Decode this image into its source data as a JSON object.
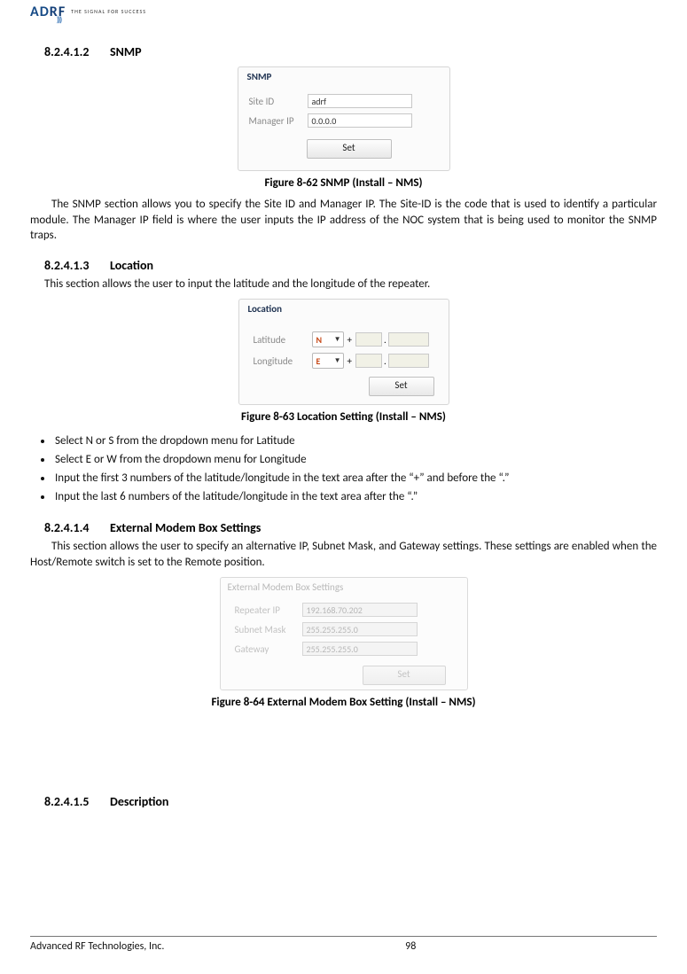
{
  "header": {
    "logo_a": "A",
    "logo_d": "D",
    "logo_r": "R",
    "logo_f": "F",
    "tagline": "THE SIGNAL FOR SUCCESS"
  },
  "sections": {
    "snmp": {
      "num": "8.2.4.1.2",
      "title": "SNMP"
    },
    "location": {
      "num": "8.2.4.1.3",
      "title": "Location"
    },
    "ext": {
      "num": "8.2.4.1.4",
      "title": "External Modem Box Settings"
    },
    "desc": {
      "num": "8.2.4.1.5",
      "title": "Description"
    }
  },
  "snmp_box": {
    "title": "SNMP",
    "site_label": "Site ID",
    "site_value": "adrf",
    "mgr_label": "Manager IP",
    "mgr_value": "0.0.0.0",
    "btn": "Set"
  },
  "fig62": "Figure 8-62    SNMP (Install – NMS)",
  "para_snmp": "The SNMP section allows you to specify the Site ID and Manager IP.  The Site-ID is the code that is used to identify a particular module.  The Manager IP field is where the user inputs the IP address of the NOC system that is being used to monitor the SNMP traps.",
  "para_loc_intro": "This section allows the user to input the latitude and the longitude of the repeater.",
  "loc_box": {
    "title": "Location",
    "lat_label": "Latitude",
    "lon_label": "Longitude",
    "lat_sel": "N",
    "lon_sel": "E",
    "plus": "+",
    "dot": ".",
    "btn": "Set"
  },
  "fig63": "Figure 8-63    Location Setting (Install – NMS)",
  "bullets": {
    "b1": "Select N or S from the dropdown menu for Latitude",
    "b2": "Select E or W from the dropdown menu for Longitude",
    "b3": "Input the first 3 numbers of the latitude/longitude in the text area after the “+” and before the “.”",
    "b4": "Input the last 6 numbers of the latitude/longitude in the text area after the “.”"
  },
  "para_ext": "This section allows the user to specify an alternative IP, Subnet Mask, and Gateway settings.  These settings are enabled when the Host/Remote switch is set to the Remote position.",
  "ext_box": {
    "title": "External Modem Box Settings",
    "rep_label": "Repeater IP",
    "rep_value": "192.168.70.202",
    "sub_label": "Subnet Mask",
    "sub_value": "255.255.255.0",
    "gw_label": "Gateway",
    "gw_value": "255.255.255.0",
    "btn": "Set"
  },
  "fig64": "Figure 8-64    External Modem Box Setting (Install – NMS)",
  "footer": {
    "left": "Advanced RF Technologies, Inc.",
    "page": "98"
  }
}
